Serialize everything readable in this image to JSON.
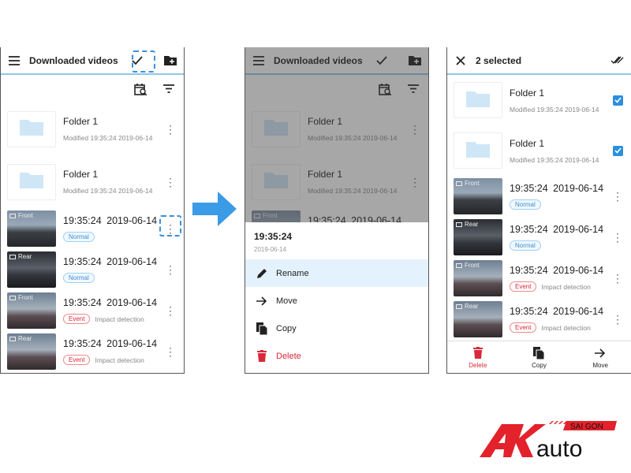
{
  "screen1": {
    "title": "Downloaded videos",
    "items": [
      {
        "kind": "folder",
        "title": "Folder 1",
        "modified": "Modified 19:35:24 2019-06-14"
      },
      {
        "kind": "folder",
        "title": "Folder 1",
        "modified": "Modified 19:35:24 2019-06-14"
      },
      {
        "kind": "video",
        "camera": "Front",
        "title": "19:35:24  2019-06-14",
        "badge": "Normal",
        "note": ""
      },
      {
        "kind": "video",
        "camera": "Rear",
        "title": "19:35:24  2019-06-14",
        "badge": "Normal",
        "note": ""
      },
      {
        "kind": "video",
        "camera": "Front",
        "title": "19:35:24  2019-06-14",
        "badge": "Event",
        "note": "Impact detection"
      },
      {
        "kind": "video",
        "camera": "Rear",
        "title": "19:35:24  2019-06-14",
        "badge": "Event",
        "note": "Impact detection"
      }
    ]
  },
  "screen2": {
    "title": "Downloaded videos",
    "sheet": {
      "time": "19:35:24",
      "date": "2019-06-14",
      "menu": [
        {
          "label": "Rename",
          "icon": "pencil-icon",
          "selected": true
        },
        {
          "label": "Move",
          "icon": "arrow-right-icon"
        },
        {
          "label": "Copy",
          "icon": "copy-icon"
        },
        {
          "label": "Delete",
          "icon": "trash-icon",
          "danger": true
        }
      ]
    }
  },
  "screen3": {
    "title": "2 selected",
    "items": [
      {
        "kind": "folder",
        "title": "Folder 1",
        "modified": "Modified 19:35:24 2019-06-14",
        "checked": true
      },
      {
        "kind": "folder",
        "title": "Folder 1",
        "modified": "Modified 19:35:24 2019-06-14",
        "checked": true
      },
      {
        "kind": "video",
        "camera": "Front",
        "title": "19:35:24  2019-06-14",
        "badge": "Normal",
        "note": ""
      },
      {
        "kind": "video",
        "camera": "Rear",
        "title": "19:35:24  2019-06-14",
        "badge": "Normal",
        "note": ""
      },
      {
        "kind": "video",
        "camera": "Front",
        "title": "19:35:24  2019-06-14",
        "badge": "Event",
        "note": "Impact detection"
      },
      {
        "kind": "video",
        "camera": "Rear",
        "title": "19:35:24  2019-06-14",
        "badge": "Event",
        "note": "Impact detection"
      }
    ],
    "bottom_bar": [
      {
        "label": "Delete",
        "icon": "trash-icon",
        "danger": true
      },
      {
        "label": "Copy",
        "icon": "copy-icon"
      },
      {
        "label": "Move",
        "icon": "arrow-right-icon"
      }
    ]
  },
  "logo": {
    "text": "AK auto SAI GON"
  },
  "colors": {
    "accent": "#3b8fe0",
    "danger": "#d9283a",
    "divider": "#8cc8ea",
    "logo_red": "#e3222b"
  }
}
